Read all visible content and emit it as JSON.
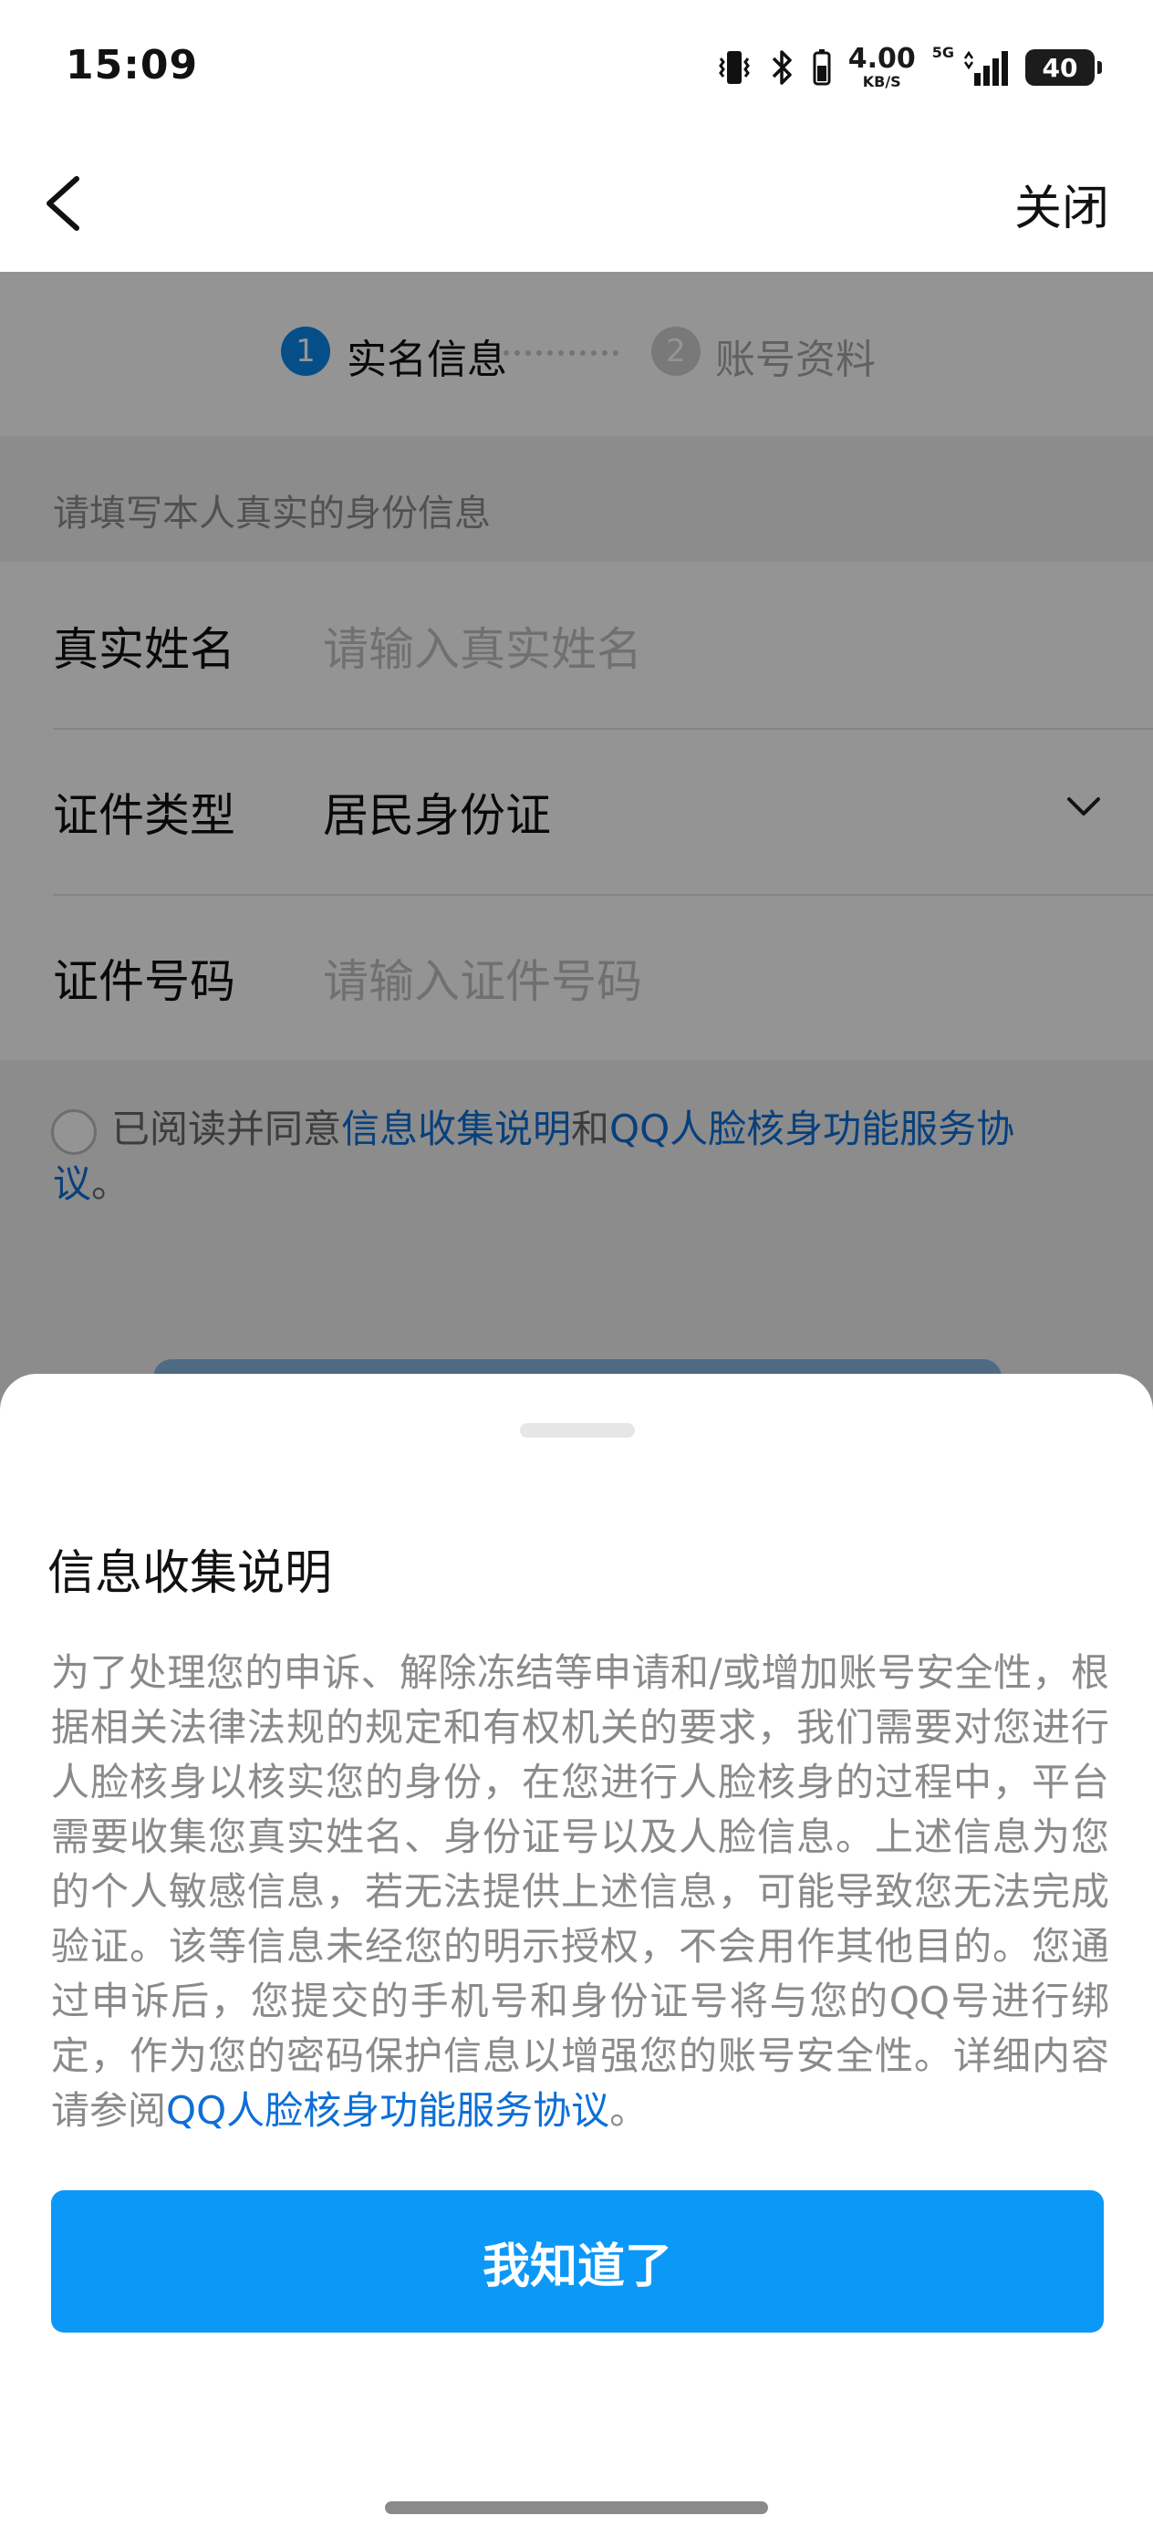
{
  "status_bar": {
    "time": "15:09",
    "net_speed_value": "4.00",
    "net_speed_unit": "KB/S",
    "network": "5G",
    "battery": "40"
  },
  "nav": {
    "close_label": "关闭"
  },
  "steps": [
    {
      "num": "1",
      "label": "实名信息"
    },
    {
      "num": "2",
      "label": "账号资料"
    }
  ],
  "hint": "请填写本人真实的身份信息",
  "form": {
    "name_label": "真实姓名",
    "name_placeholder": "请输入真实姓名",
    "id_type_label": "证件类型",
    "id_type_value": "居民身份证",
    "id_no_label": "证件号码",
    "id_no_placeholder": "请输入证件号码"
  },
  "agreement": {
    "prefix": "已阅读并同意",
    "link1": "信息收集说明",
    "and": "和",
    "link2": "QQ人脸核身功能服务协议",
    "suffix": "。"
  },
  "sheet": {
    "title": "信息收集说明",
    "body": "为了处理您的申诉、解除冻结等申请和/或增加账号安全性，根据相关法律法规的规定和有权机关的要求，我们需要对您进行人脸核身以核实您的身份，在您进行人脸核身的过程中，平台需要收集您真实姓名、身份证号以及人脸信息。上述信息为您的个人敏感信息，若无法提供上述信息，可能导致您无法完成验证。该等信息未经您的明示授权，不会用作其他目的。您通过申诉后，您提交的手机号和身份证号将与您的QQ号进行绑定，作为您的密码保护信息以增强您的账号安全性。详细内容请参阅",
    "body_link": "QQ人脸核身功能服务协议",
    "body_end": "。",
    "button_label": "我知道了"
  },
  "colors": {
    "accent": "#0c98f7",
    "link": "#0e6fd6",
    "step_active": "#0b87e8"
  }
}
